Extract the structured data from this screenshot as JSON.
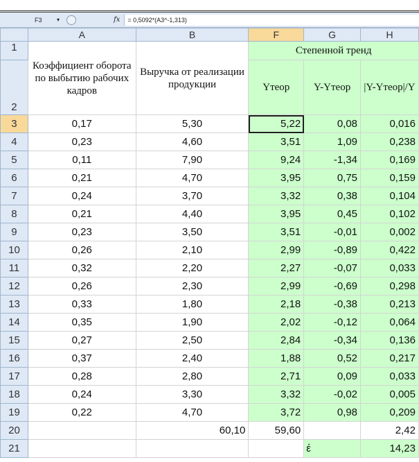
{
  "formula_bar": {
    "cell_ref": "F3",
    "fx_symbol": "fx",
    "formula": "= 0,5092*(A3^-1,313)"
  },
  "columns": [
    "A",
    "B",
    "F",
    "G",
    "H"
  ],
  "header": {
    "col_a": "Коэффициент оборота по выбытию рабочих кадров",
    "col_b": "Выручка от реализации продукции",
    "trend_title": "Степенной тренд",
    "col_f": "Yтеор",
    "col_g": "Y-Yтеор",
    "col_h": "|Y-Yтеор|/Y"
  },
  "rows": [
    {
      "num": "3",
      "a": "0,17",
      "b": "5,30",
      "f": "5,22",
      "g": "0,08",
      "h": "0,016"
    },
    {
      "num": "4",
      "a": "0,23",
      "b": "4,60",
      "f": "3,51",
      "g": "1,09",
      "h": "0,238"
    },
    {
      "num": "5",
      "a": "0,11",
      "b": "7,90",
      "f": "9,24",
      "g": "-1,34",
      "h": "0,169"
    },
    {
      "num": "6",
      "a": "0,21",
      "b": "4,70",
      "f": "3,95",
      "g": "0,75",
      "h": "0,159"
    },
    {
      "num": "7",
      "a": "0,24",
      "b": "3,70",
      "f": "3,32",
      "g": "0,38",
      "h": "0,104"
    },
    {
      "num": "8",
      "a": "0,21",
      "b": "4,40",
      "f": "3,95",
      "g": "0,45",
      "h": "0,102"
    },
    {
      "num": "9",
      "a": "0,23",
      "b": "3,50",
      "f": "3,51",
      "g": "-0,01",
      "h": "0,002"
    },
    {
      "num": "10",
      "a": "0,26",
      "b": "2,10",
      "f": "2,99",
      "g": "-0,89",
      "h": "0,422"
    },
    {
      "num": "11",
      "a": "0,32",
      "b": "2,20",
      "f": "2,27",
      "g": "-0,07",
      "h": "0,033"
    },
    {
      "num": "12",
      "a": "0,26",
      "b": "2,30",
      "f": "2,99",
      "g": "-0,69",
      "h": "0,298"
    },
    {
      "num": "13",
      "a": "0,33",
      "b": "1,80",
      "f": "2,18",
      "g": "-0,38",
      "h": "0,213"
    },
    {
      "num": "14",
      "a": "0,35",
      "b": "1,90",
      "f": "2,02",
      "g": "-0,12",
      "h": "0,064"
    },
    {
      "num": "15",
      "a": "0,27",
      "b": "2,50",
      "f": "2,84",
      "g": "-0,34",
      "h": "0,136"
    },
    {
      "num": "16",
      "a": "0,37",
      "b": "2,40",
      "f": "1,88",
      "g": "0,52",
      "h": "0,217"
    },
    {
      "num": "17",
      "a": "0,28",
      "b": "2,80",
      "f": "2,71",
      "g": "0,09",
      "h": "0,033"
    },
    {
      "num": "18",
      "a": "0,24",
      "b": "3,30",
      "f": "3,32",
      "g": "-0,02",
      "h": "0,005"
    },
    {
      "num": "19",
      "a": "0,22",
      "b": "4,70",
      "f": "3,72",
      "g": "0,98",
      "h": "0,209"
    }
  ],
  "totals": {
    "num": "20",
    "b": "60,10",
    "f": "59,60",
    "h": "2,42"
  },
  "error_row": {
    "num": "21",
    "g": "έ",
    "h": "14,23"
  },
  "header_row_nums": [
    "1",
    "2"
  ]
}
